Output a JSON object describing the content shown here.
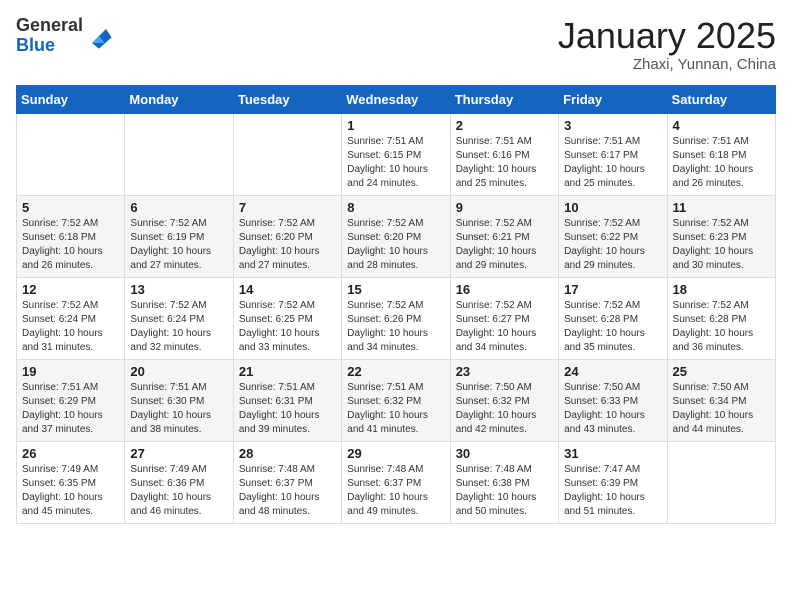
{
  "header": {
    "logo_general": "General",
    "logo_blue": "Blue",
    "month_title": "January 2025",
    "subtitle": "Zhaxi, Yunnan, China"
  },
  "days_of_week": [
    "Sunday",
    "Monday",
    "Tuesday",
    "Wednesday",
    "Thursday",
    "Friday",
    "Saturday"
  ],
  "weeks": [
    [
      {
        "day": "",
        "info": ""
      },
      {
        "day": "",
        "info": ""
      },
      {
        "day": "",
        "info": ""
      },
      {
        "day": "1",
        "info": "Sunrise: 7:51 AM\nSunset: 6:15 PM\nDaylight: 10 hours and 24 minutes."
      },
      {
        "day": "2",
        "info": "Sunrise: 7:51 AM\nSunset: 6:16 PM\nDaylight: 10 hours and 25 minutes."
      },
      {
        "day": "3",
        "info": "Sunrise: 7:51 AM\nSunset: 6:17 PM\nDaylight: 10 hours and 25 minutes."
      },
      {
        "day": "4",
        "info": "Sunrise: 7:51 AM\nSunset: 6:18 PM\nDaylight: 10 hours and 26 minutes."
      }
    ],
    [
      {
        "day": "5",
        "info": "Sunrise: 7:52 AM\nSunset: 6:18 PM\nDaylight: 10 hours and 26 minutes."
      },
      {
        "day": "6",
        "info": "Sunrise: 7:52 AM\nSunset: 6:19 PM\nDaylight: 10 hours and 27 minutes."
      },
      {
        "day": "7",
        "info": "Sunrise: 7:52 AM\nSunset: 6:20 PM\nDaylight: 10 hours and 27 minutes."
      },
      {
        "day": "8",
        "info": "Sunrise: 7:52 AM\nSunset: 6:20 PM\nDaylight: 10 hours and 28 minutes."
      },
      {
        "day": "9",
        "info": "Sunrise: 7:52 AM\nSunset: 6:21 PM\nDaylight: 10 hours and 29 minutes."
      },
      {
        "day": "10",
        "info": "Sunrise: 7:52 AM\nSunset: 6:22 PM\nDaylight: 10 hours and 29 minutes."
      },
      {
        "day": "11",
        "info": "Sunrise: 7:52 AM\nSunset: 6:23 PM\nDaylight: 10 hours and 30 minutes."
      }
    ],
    [
      {
        "day": "12",
        "info": "Sunrise: 7:52 AM\nSunset: 6:24 PM\nDaylight: 10 hours and 31 minutes."
      },
      {
        "day": "13",
        "info": "Sunrise: 7:52 AM\nSunset: 6:24 PM\nDaylight: 10 hours and 32 minutes."
      },
      {
        "day": "14",
        "info": "Sunrise: 7:52 AM\nSunset: 6:25 PM\nDaylight: 10 hours and 33 minutes."
      },
      {
        "day": "15",
        "info": "Sunrise: 7:52 AM\nSunset: 6:26 PM\nDaylight: 10 hours and 34 minutes."
      },
      {
        "day": "16",
        "info": "Sunrise: 7:52 AM\nSunset: 6:27 PM\nDaylight: 10 hours and 34 minutes."
      },
      {
        "day": "17",
        "info": "Sunrise: 7:52 AM\nSunset: 6:28 PM\nDaylight: 10 hours and 35 minutes."
      },
      {
        "day": "18",
        "info": "Sunrise: 7:52 AM\nSunset: 6:28 PM\nDaylight: 10 hours and 36 minutes."
      }
    ],
    [
      {
        "day": "19",
        "info": "Sunrise: 7:51 AM\nSunset: 6:29 PM\nDaylight: 10 hours and 37 minutes."
      },
      {
        "day": "20",
        "info": "Sunrise: 7:51 AM\nSunset: 6:30 PM\nDaylight: 10 hours and 38 minutes."
      },
      {
        "day": "21",
        "info": "Sunrise: 7:51 AM\nSunset: 6:31 PM\nDaylight: 10 hours and 39 minutes."
      },
      {
        "day": "22",
        "info": "Sunrise: 7:51 AM\nSunset: 6:32 PM\nDaylight: 10 hours and 41 minutes."
      },
      {
        "day": "23",
        "info": "Sunrise: 7:50 AM\nSunset: 6:32 PM\nDaylight: 10 hours and 42 minutes."
      },
      {
        "day": "24",
        "info": "Sunrise: 7:50 AM\nSunset: 6:33 PM\nDaylight: 10 hours and 43 minutes."
      },
      {
        "day": "25",
        "info": "Sunrise: 7:50 AM\nSunset: 6:34 PM\nDaylight: 10 hours and 44 minutes."
      }
    ],
    [
      {
        "day": "26",
        "info": "Sunrise: 7:49 AM\nSunset: 6:35 PM\nDaylight: 10 hours and 45 minutes."
      },
      {
        "day": "27",
        "info": "Sunrise: 7:49 AM\nSunset: 6:36 PM\nDaylight: 10 hours and 46 minutes."
      },
      {
        "day": "28",
        "info": "Sunrise: 7:48 AM\nSunset: 6:37 PM\nDaylight: 10 hours and 48 minutes."
      },
      {
        "day": "29",
        "info": "Sunrise: 7:48 AM\nSunset: 6:37 PM\nDaylight: 10 hours and 49 minutes."
      },
      {
        "day": "30",
        "info": "Sunrise: 7:48 AM\nSunset: 6:38 PM\nDaylight: 10 hours and 50 minutes."
      },
      {
        "day": "31",
        "info": "Sunrise: 7:47 AM\nSunset: 6:39 PM\nDaylight: 10 hours and 51 minutes."
      },
      {
        "day": "",
        "info": ""
      }
    ]
  ]
}
